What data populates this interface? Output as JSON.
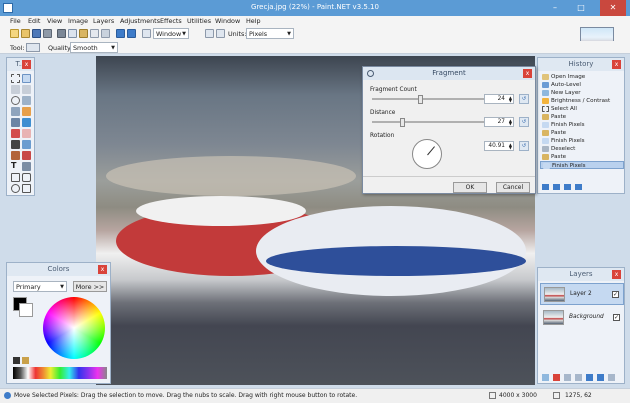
{
  "window": {
    "title": "Grecja.jpg (22%) - Paint.NET v3.5.10",
    "minimize": "–",
    "maximize": "□",
    "close": "✕"
  },
  "menu": [
    "File",
    "Edit",
    "View",
    "Image",
    "Layers",
    "Adjustments",
    "Effects",
    "Utilities",
    "Window",
    "Help"
  ],
  "toolbar": {
    "zoom_value": "Window",
    "units_label": "Units:",
    "units_value": "Pixels",
    "tool_label": "Tool:",
    "quality_label": "Quality:",
    "quality_value": "Smooth"
  },
  "tools_panel": {
    "title": "T...",
    "close": "x"
  },
  "colors_panel": {
    "title": "Colors",
    "close": "x",
    "mode": "Primary",
    "more_button": "More >>"
  },
  "history_panel": {
    "title": "History",
    "close": "x",
    "items": [
      "Open Image",
      "Auto-Level",
      "New Layer",
      "Brightness / Contrast",
      "Select All",
      "Paste",
      "Finish Pixels",
      "Paste",
      "Finish Pixels",
      "Deselect",
      "Paste",
      "Finish Pixels"
    ]
  },
  "layers_panel": {
    "title": "Layers",
    "close": "x",
    "layers": [
      {
        "name": "Layer 2",
        "visible": true,
        "selected": true
      },
      {
        "name": "Background",
        "visible": true,
        "selected": false
      }
    ]
  },
  "dialog": {
    "title": "Fragment",
    "close": "x",
    "fragment_count_label": "Fragment Count",
    "fragment_count_value": "24",
    "distance_label": "Distance",
    "distance_value": "27",
    "rotation_label": "Rotation",
    "rotation_value": "40.91",
    "ok_button": "OK",
    "cancel_button": "Cancel"
  },
  "statusbar": {
    "message": "Move Selected Pixels: Drag the selection to move. Drag the nubs to scale. Drag with right mouse button to rotate.",
    "image_size": "4000 x 3000",
    "cursor_pos": "1275, 62"
  }
}
